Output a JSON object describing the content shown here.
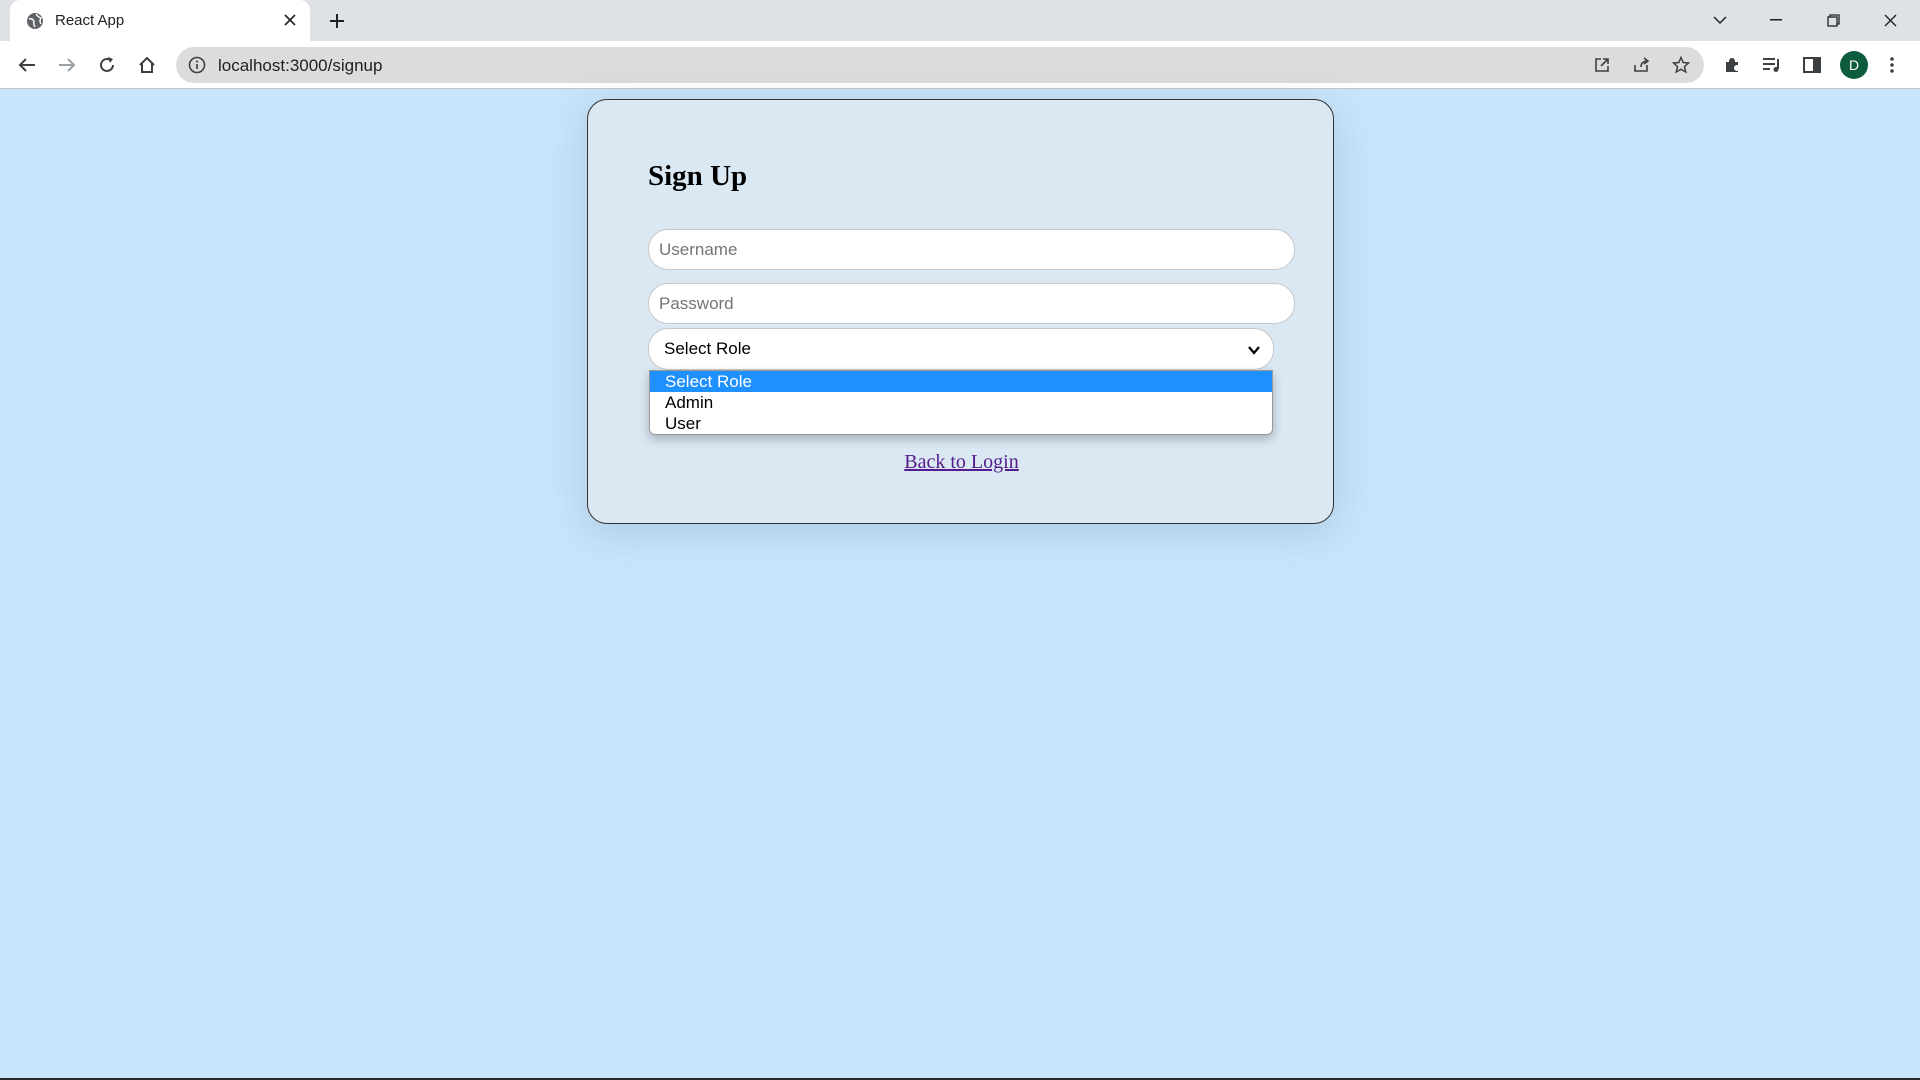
{
  "browser": {
    "tab_title": "React App",
    "url": "localhost:3000/signup",
    "profile_initial": "D"
  },
  "form": {
    "title": "Sign Up",
    "username_placeholder": "Username",
    "password_placeholder": "Password",
    "role_selected": "Select Role",
    "role_options": [
      "Select Role",
      "Admin",
      "User"
    ],
    "back_link": "Back to Login"
  },
  "colors": {
    "page_bg": "#c8e5fb",
    "card_bg": "#dae8f4",
    "option_highlight": "#1e90ff",
    "link": "#551a8b"
  }
}
